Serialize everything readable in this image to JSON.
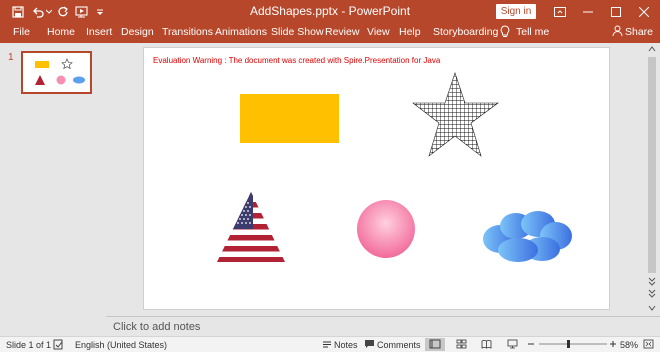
{
  "window": {
    "document_title": "AddShapes.pptx",
    "app_name": "PowerPoint",
    "title_text": "AddShapes.pptx  -  PowerPoint",
    "signin_label": "Sign in"
  },
  "menu": {
    "items": [
      "File",
      "Home",
      "Insert",
      "Design",
      "Transitions",
      "Animations",
      "Slide Show",
      "Review",
      "View",
      "Help",
      "Storyboarding"
    ],
    "tell_me": "Tell me",
    "share": "Share"
  },
  "thumbnails": {
    "slide_number": "1"
  },
  "slide": {
    "warning_text": "Evaluation Warning : The document was created with  Spire.Presentation for Java",
    "shapes": [
      {
        "name": "rectangle-shape",
        "kind": "rectangle",
        "fill": "#ffc000"
      },
      {
        "name": "star-shape",
        "kind": "five-point-star",
        "fill": "grid-pattern"
      },
      {
        "name": "triangle-shape",
        "kind": "triangle",
        "fill": "us-flag-picture"
      },
      {
        "name": "circle-shape",
        "kind": "ellipse",
        "fill": "pink-radial-gradient"
      },
      {
        "name": "cloud-shape",
        "kind": "cloud",
        "fill": "blue-gradient"
      }
    ]
  },
  "notes": {
    "placeholder": "Click to add notes"
  },
  "status": {
    "slide_info": "Slide 1 of 1",
    "language": "English (United States)",
    "notes_label": "Notes",
    "comments_label": "Comments",
    "zoom": "58%"
  },
  "colors": {
    "accent": "#b7472a",
    "warning": "#e00000"
  }
}
